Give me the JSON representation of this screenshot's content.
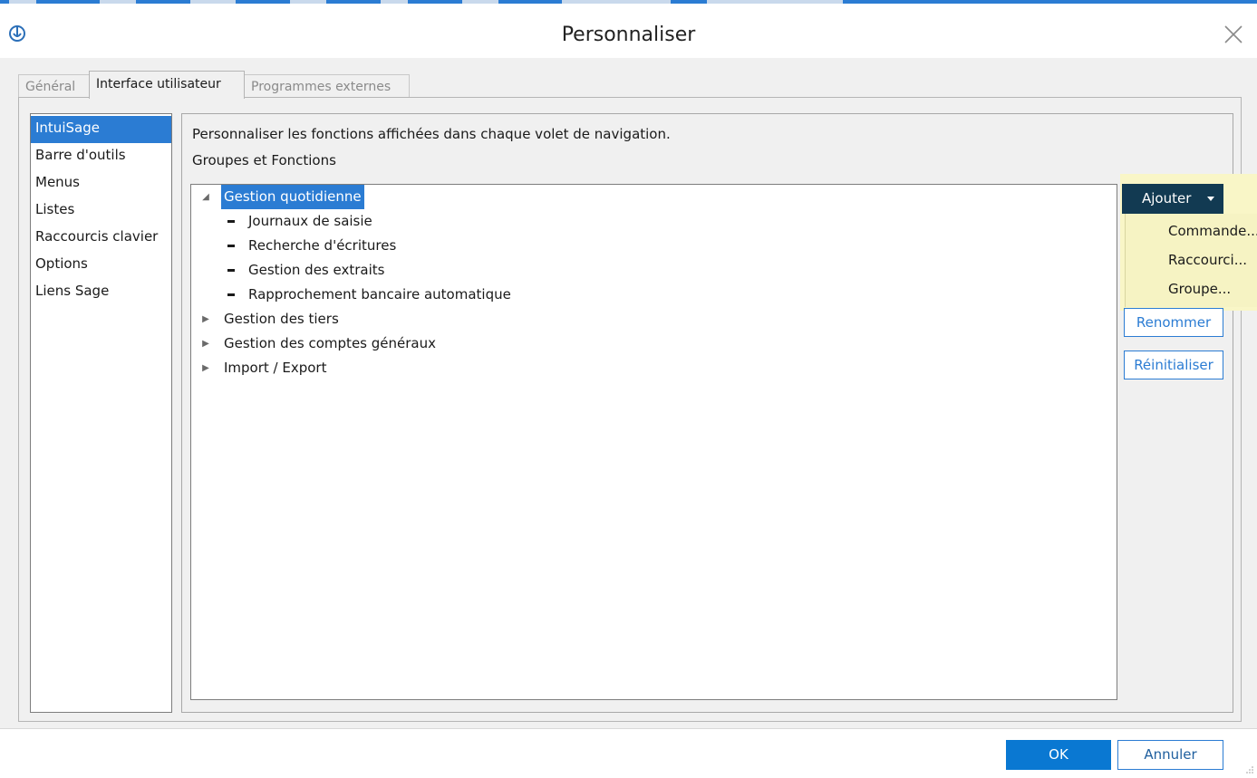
{
  "window": {
    "title": "Personnaliser",
    "app_icon": "sage-logo-icon",
    "close_icon": "close-icon"
  },
  "tabs": [
    {
      "label": "Général",
      "active": false
    },
    {
      "label": "Interface utilisateur",
      "active": true
    },
    {
      "label": "Programmes externes",
      "active": false
    }
  ],
  "sidebar": {
    "items": [
      {
        "label": "IntuiSage",
        "selected": true
      },
      {
        "label": "Barre d'outils"
      },
      {
        "label": "Menus"
      },
      {
        "label": "Listes"
      },
      {
        "label": "Raccourcis clavier"
      },
      {
        "label": "Options"
      },
      {
        "label": "Liens Sage"
      }
    ]
  },
  "content": {
    "description": "Personnaliser les fonctions affichées dans chaque volet de navigation.",
    "section_label": "Groupes et Fonctions"
  },
  "tree": {
    "groups": [
      {
        "label": "Gestion quotidienne",
        "expanded": true,
        "selected": true,
        "children": [
          "Journaux de saisie",
          "Recherche d'écritures",
          "Gestion des extraits",
          "Rapprochement bancaire automatique"
        ]
      },
      {
        "label": "Gestion des tiers",
        "expanded": false
      },
      {
        "label": "Gestion des comptes généraux",
        "expanded": false
      },
      {
        "label": "Import / Export",
        "expanded": false
      }
    ]
  },
  "actions": {
    "add_label": "Ajouter",
    "add_menu": [
      "Commande...",
      "Raccourci...",
      "Groupe..."
    ],
    "rename_label": "Renommer",
    "reset_label": "Réinitialiser"
  },
  "footer": {
    "ok_label": "OK",
    "cancel_label": "Annuler"
  },
  "colors": {
    "accent": "#2b7cd3",
    "primary_button": "#0a78d2",
    "add_button": "#123a52",
    "menu_highlight": "#f6f3c3"
  }
}
